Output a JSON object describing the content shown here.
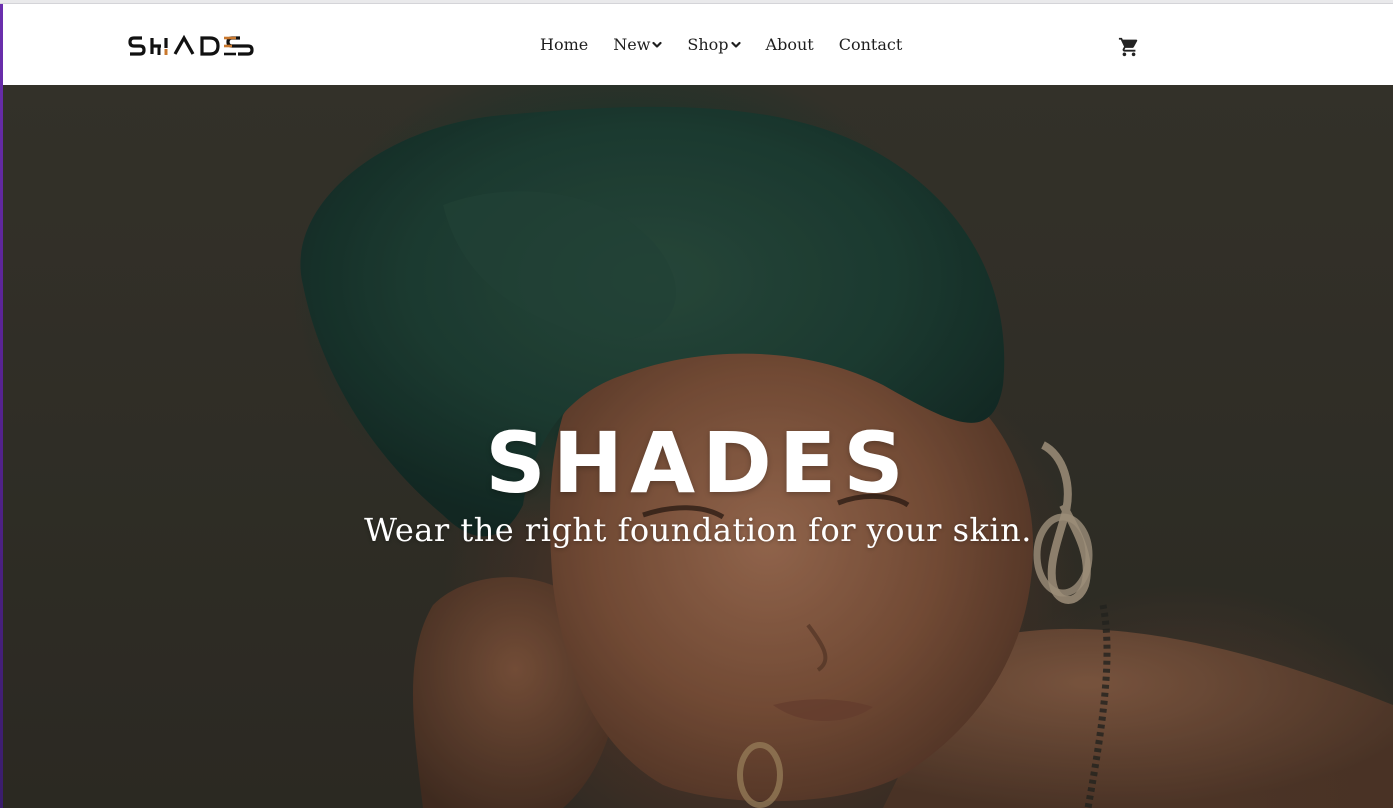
{
  "brand": {
    "logo_text": "SHADES",
    "logo_accent_color": "#c9782e"
  },
  "nav": {
    "items": [
      {
        "label": "Home",
        "has_dropdown": false
      },
      {
        "label": "New",
        "has_dropdown": true
      },
      {
        "label": "Shop",
        "has_dropdown": true
      },
      {
        "label": "About",
        "has_dropdown": false
      },
      {
        "label": "Contact",
        "has_dropdown": false
      }
    ],
    "cart_icon": "shopping-cart-icon"
  },
  "hero": {
    "title": "SHADES",
    "subtitle": "Wear the right foundation for your skin."
  },
  "colors": {
    "nav_text": "#1f1f1f",
    "hero_text": "#ffffff",
    "headwrap_green": "#1f3d32",
    "background": "#3a382f"
  }
}
